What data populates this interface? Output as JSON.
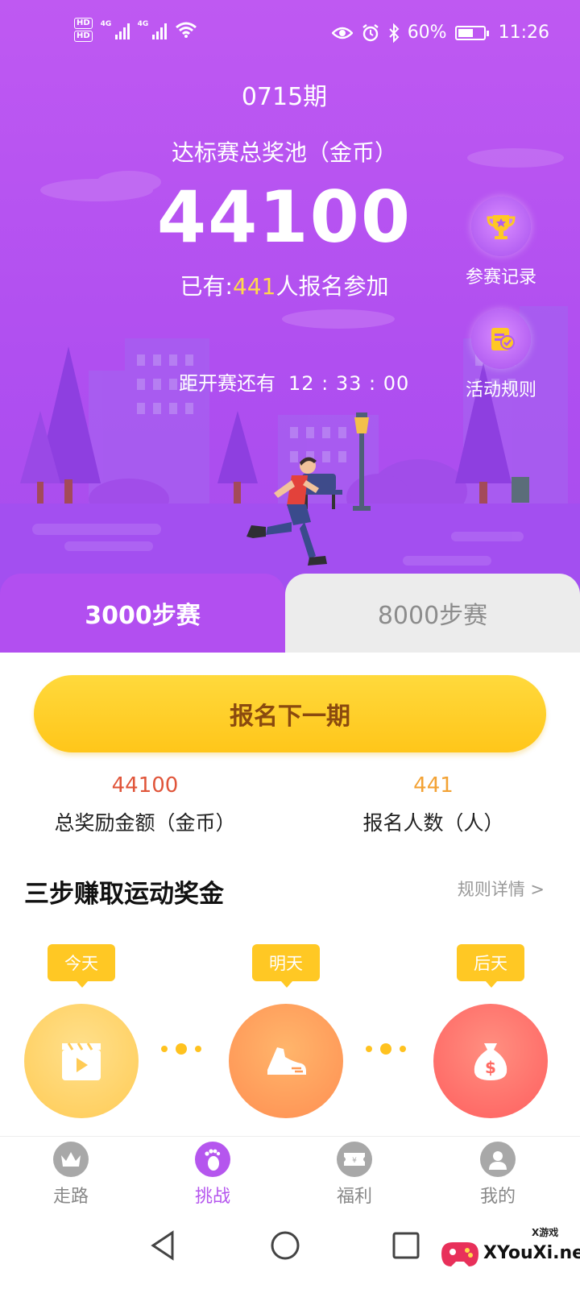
{
  "status_bar": {
    "hd1": "HD",
    "hd2": "HD",
    "net1": "4G",
    "net2": "4G",
    "battery_pct_text": "60%",
    "battery_level": 0.6,
    "time": "11:26"
  },
  "header": {
    "period": "0715期",
    "pool_label": "达标赛总奖池（金币）",
    "pool_amount": "44100",
    "signed_prefix": "已有:",
    "signed_count": "441",
    "signed_suffix": "人报名参加",
    "countdown_label": "距开赛还有",
    "countdown_time": "12 : 33 : 00"
  },
  "side_buttons": {
    "records_label": "参赛记录",
    "rules_label": "活动规则"
  },
  "race_tabs": {
    "active": "3000步赛",
    "inactive": "8000步赛"
  },
  "signup_button": "报名下一期",
  "stats": {
    "reward_value": "44100",
    "reward_label": "总奖励金额（金币）",
    "signup_value": "441",
    "signup_label": "报名人数（人）",
    "reward_color": "#e0553a",
    "signup_color": "#f3a234"
  },
  "steps_section": {
    "title": "三步赚取运动奖金",
    "rules_link": "规则详情 >",
    "steps": [
      {
        "day": "今天",
        "icon": "video-play-icon"
      },
      {
        "day": "明天",
        "icon": "running-shoe-icon"
      },
      {
        "day": "后天",
        "icon": "money-bag-icon"
      }
    ]
  },
  "bottom_nav": {
    "items": [
      {
        "label": "走路",
        "icon": "crown-icon"
      },
      {
        "label": "挑战",
        "icon": "footprint-icon"
      },
      {
        "label": "福利",
        "icon": "coupon-icon"
      },
      {
        "label": "我的",
        "icon": "user-icon"
      }
    ],
    "active_index": 1
  },
  "watermark": {
    "small": "X游戏",
    "site": "XYouXi.net"
  },
  "colors": {
    "hero_purple": "#b04ff0",
    "accent_yellow": "#ffc824",
    "active_tab_text": "#b556ee"
  }
}
